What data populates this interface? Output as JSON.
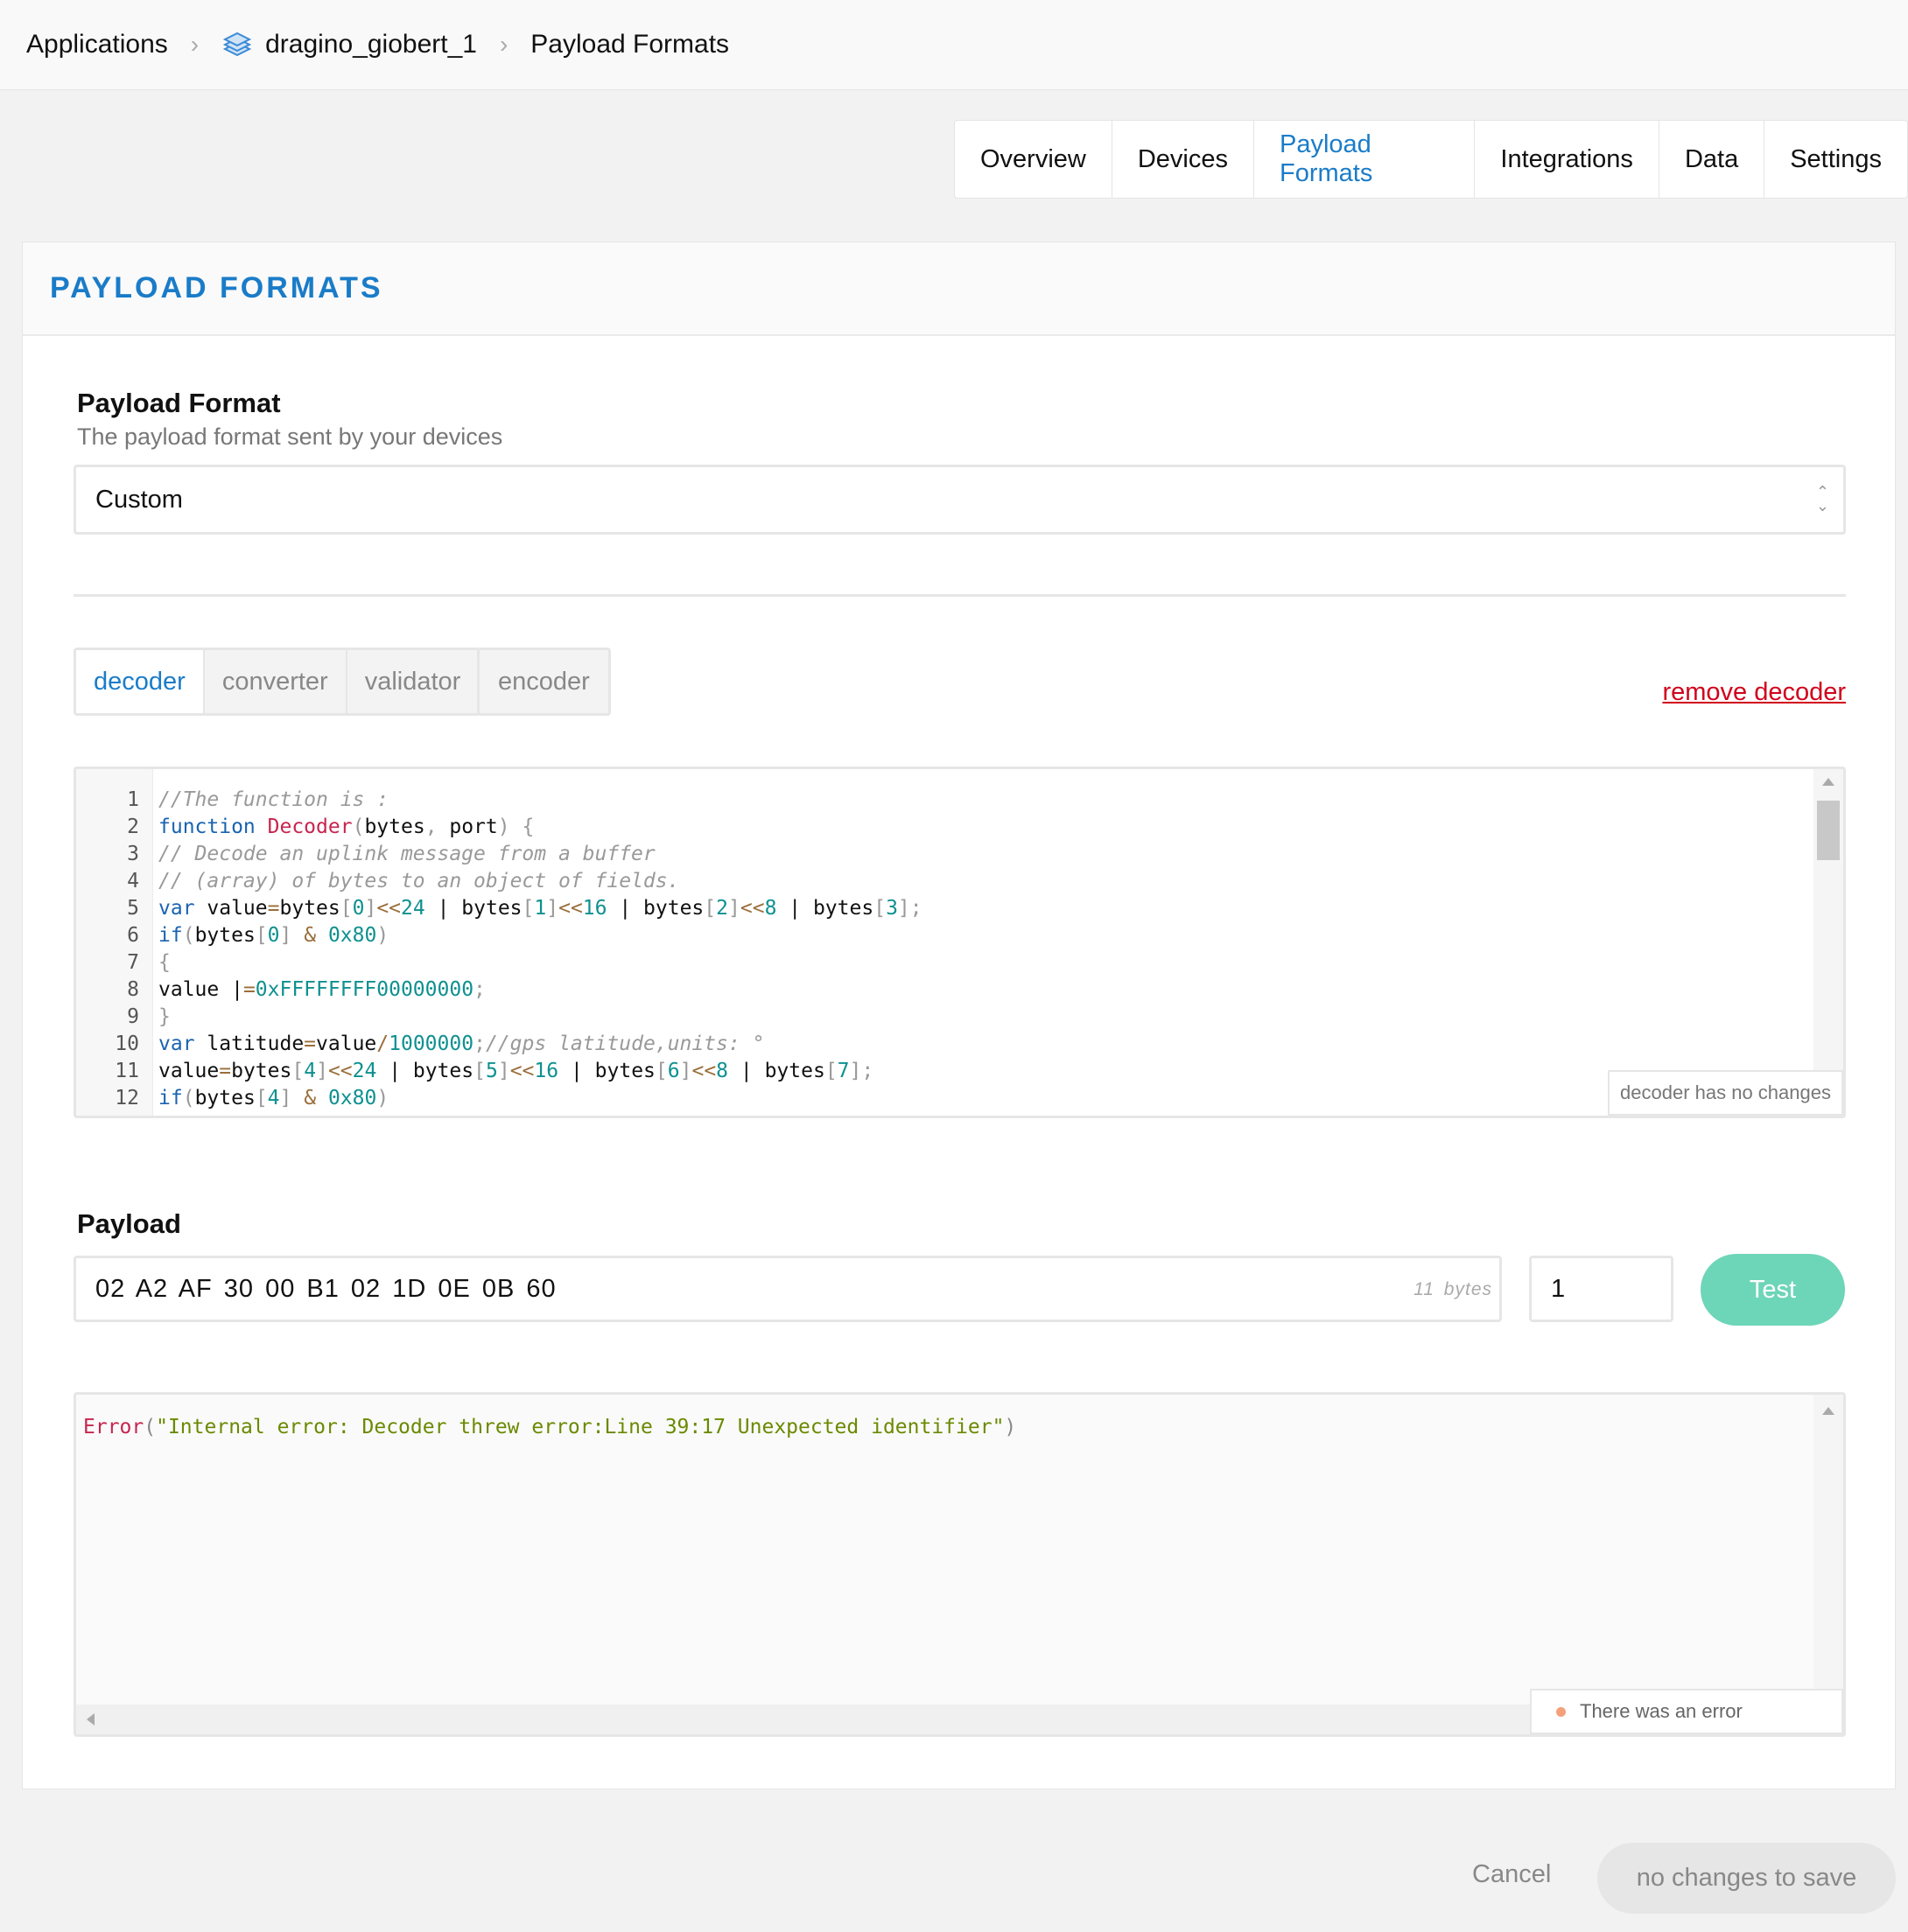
{
  "breadcrumb": {
    "items": [
      "Applications",
      "dragino_giobert_1",
      "Payload Formats"
    ],
    "app_icon": "layers-icon"
  },
  "tabs": [
    "Overview",
    "Devices",
    "Payload Formats",
    "Integrations",
    "Data",
    "Settings"
  ],
  "active_tab": "Payload Formats",
  "card": {
    "title": "PAYLOAD FORMATS"
  },
  "payload_format": {
    "label": "Payload Format",
    "description": "The payload format sent by your devices",
    "selected": "Custom"
  },
  "function_tabs": {
    "group": [
      "decoder",
      "converter",
      "validator"
    ],
    "separate": "encoder",
    "active": "decoder"
  },
  "remove_label": "remove decoder",
  "editor": {
    "status": "decoder has no changes",
    "lines": [
      [
        [
          "c",
          "//The function is :"
        ]
      ],
      [
        [
          "k",
          "function"
        ],
        [
          "p",
          " "
        ],
        [
          "f",
          "Decoder"
        ],
        [
          "b",
          "("
        ],
        [
          "p",
          "bytes"
        ],
        [
          "b",
          ", "
        ],
        [
          "p",
          "port"
        ],
        [
          "b",
          ") {"
        ]
      ],
      [
        [
          "c",
          "// Decode an uplink message from a buffer"
        ]
      ],
      [
        [
          "c",
          "// (array) of bytes to an object of fields."
        ]
      ],
      [
        [
          "k",
          "var"
        ],
        [
          "p",
          " value"
        ],
        [
          "o",
          "="
        ],
        [
          "p",
          "bytes"
        ],
        [
          "b",
          "["
        ],
        [
          "n",
          "0"
        ],
        [
          "b",
          "]"
        ],
        [
          "o",
          "<<"
        ],
        [
          "n",
          "24"
        ],
        [
          "p",
          " | bytes"
        ],
        [
          "b",
          "["
        ],
        [
          "n",
          "1"
        ],
        [
          "b",
          "]"
        ],
        [
          "o",
          "<<"
        ],
        [
          "n",
          "16"
        ],
        [
          "p",
          " | bytes"
        ],
        [
          "b",
          "["
        ],
        [
          "n",
          "2"
        ],
        [
          "b",
          "]"
        ],
        [
          "o",
          "<<"
        ],
        [
          "n",
          "8"
        ],
        [
          "p",
          " | bytes"
        ],
        [
          "b",
          "["
        ],
        [
          "n",
          "3"
        ],
        [
          "b",
          "];"
        ]
      ],
      [
        [
          "k",
          "if"
        ],
        [
          "b",
          "("
        ],
        [
          "p",
          "bytes"
        ],
        [
          "b",
          "["
        ],
        [
          "n",
          "0"
        ],
        [
          "b",
          "]"
        ],
        [
          "o",
          " & "
        ],
        [
          "n",
          "0x80"
        ],
        [
          "b",
          ")"
        ]
      ],
      [
        [
          "b",
          "{"
        ]
      ],
      [
        [
          "p",
          "value |"
        ],
        [
          "o",
          "="
        ],
        [
          "n",
          "0xFFFFFFFF00000000"
        ],
        [
          "b",
          ";"
        ]
      ],
      [
        [
          "b",
          "}"
        ]
      ],
      [
        [
          "k",
          "var"
        ],
        [
          "p",
          " latitude"
        ],
        [
          "o",
          "="
        ],
        [
          "p",
          "value"
        ],
        [
          "o",
          "/"
        ],
        [
          "n",
          "1000000"
        ],
        [
          "b",
          ";"
        ],
        [
          "c",
          "//gps latitude,units: °"
        ]
      ],
      [
        [
          "p",
          "value"
        ],
        [
          "o",
          "="
        ],
        [
          "p",
          "bytes"
        ],
        [
          "b",
          "["
        ],
        [
          "n",
          "4"
        ],
        [
          "b",
          "]"
        ],
        [
          "o",
          "<<"
        ],
        [
          "n",
          "24"
        ],
        [
          "p",
          " | bytes"
        ],
        [
          "b",
          "["
        ],
        [
          "n",
          "5"
        ],
        [
          "b",
          "]"
        ],
        [
          "o",
          "<<"
        ],
        [
          "n",
          "16"
        ],
        [
          "p",
          " | bytes"
        ],
        [
          "b",
          "["
        ],
        [
          "n",
          "6"
        ],
        [
          "b",
          "]"
        ],
        [
          "o",
          "<<"
        ],
        [
          "n",
          "8"
        ],
        [
          "p",
          " | bytes"
        ],
        [
          "b",
          "["
        ],
        [
          "n",
          "7"
        ],
        [
          "b",
          "];"
        ]
      ],
      [
        [
          "k",
          "if"
        ],
        [
          "b",
          "("
        ],
        [
          "p",
          "bytes"
        ],
        [
          "b",
          "["
        ],
        [
          "n",
          "4"
        ],
        [
          "b",
          "]"
        ],
        [
          "o",
          " & "
        ],
        [
          "n",
          "0x80"
        ],
        [
          "b",
          ")"
        ]
      ],
      [
        [
          "b",
          "{"
        ]
      ]
    ]
  },
  "payload": {
    "label": "Payload",
    "value": "02 A2 AF 30 00 B1 02 1D 0E 0B 60",
    "byte_count": "11 bytes",
    "port": "1",
    "test_label": "Test"
  },
  "result": {
    "error_fn": "Error",
    "error_msg": "\"Internal error: Decoder threw error:Line 39:17 Unexpected identifier\"",
    "status": "There was an error"
  },
  "footer": {
    "cancel": "Cancel",
    "save": "no changes to save"
  },
  "colors": {
    "accent": "#1a7cc8",
    "danger": "#d0021b",
    "test_button": "#6dd5b8",
    "error_dot": "#f4a07a"
  }
}
